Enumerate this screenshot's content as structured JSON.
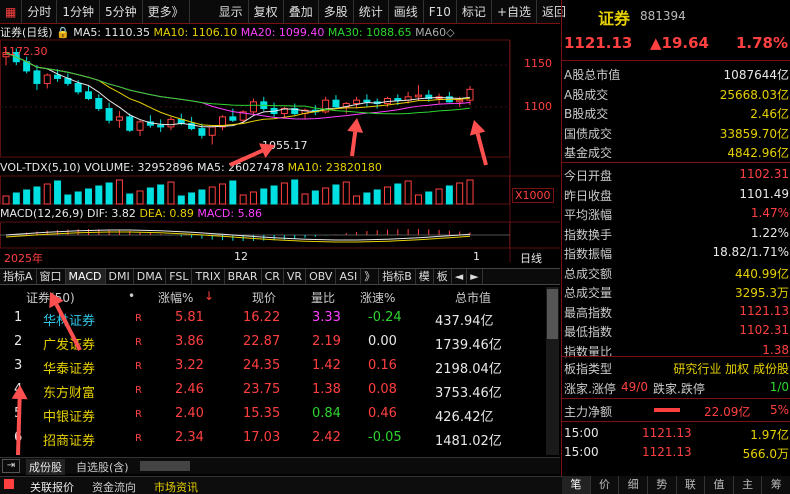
{
  "toolbar": {
    "left": [
      "分时",
      "1分钟",
      "5分钟",
      "更多》"
    ],
    "right": [
      "显示",
      "复权",
      "叠加",
      "多股",
      "统计",
      "画线",
      "F10",
      "标记",
      "+自选",
      "返回"
    ]
  },
  "main_chart": {
    "name": "证券(日线)",
    "ma5": "MA5: 1110.35",
    "ma10": "MA10: 1106.10",
    "ma20": "MA20: 1099.40",
    "ma30": "MA30: 1088.65",
    "ma60": "MA60◇",
    "high_label": "1172.30",
    "low_label": "1055.17",
    "price_ticks": [
      "1150",
      "1100"
    ],
    "year_label": "2025年",
    "month_labels": [
      "12",
      "1"
    ],
    "period_label": "日线",
    "ylim": [
      1040,
      1180
    ]
  },
  "volume": {
    "legend": "VOL-TDX(5,10)",
    "volume": "VOLUME: 32952896",
    "ma5": "MA5: 26027478",
    "ma10": "MA10: 23820180",
    "scale": "X1000"
  },
  "macd": {
    "legend": "MACD(12,26,9)",
    "dif": "DIF: 3.82",
    "dea": "DEA: 0.89",
    "macd": "MACD: 5.86"
  },
  "candles": [
    [
      1160,
      1172,
      1150,
      1165
    ],
    [
      1165,
      1170,
      1150,
      1154
    ],
    [
      1154,
      1160,
      1140,
      1143
    ],
    [
      1143,
      1150,
      1120,
      1128
    ],
    [
      1128,
      1140,
      1122,
      1138
    ],
    [
      1138,
      1145,
      1130,
      1134
    ],
    [
      1134,
      1140,
      1125,
      1128
    ],
    [
      1128,
      1132,
      1115,
      1118
    ],
    [
      1118,
      1125,
      1108,
      1110
    ],
    [
      1110,
      1115,
      1095,
      1098
    ],
    [
      1098,
      1105,
      1080,
      1084
    ],
    [
      1084,
      1095,
      1075,
      1088
    ],
    [
      1088,
      1092,
      1070,
      1072
    ],
    [
      1072,
      1085,
      1065,
      1082
    ],
    [
      1082,
      1090,
      1075,
      1078
    ],
    [
      1078,
      1085,
      1070,
      1076
    ],
    [
      1076,
      1088,
      1072,
      1085
    ],
    [
      1085,
      1092,
      1078,
      1080
    ],
    [
      1080,
      1088,
      1072,
      1074
    ],
    [
      1074,
      1080,
      1062,
      1066
    ],
    [
      1066,
      1078,
      1055,
      1076
    ],
    [
      1076,
      1090,
      1072,
      1088
    ],
    [
      1088,
      1098,
      1082,
      1084
    ],
    [
      1084,
      1096,
      1080,
      1094
    ],
    [
      1094,
      1110,
      1090,
      1106
    ],
    [
      1106,
      1112,
      1095,
      1098
    ],
    [
      1098,
      1105,
      1088,
      1092
    ],
    [
      1092,
      1100,
      1086,
      1098
    ],
    [
      1098,
      1104,
      1090,
      1092
    ],
    [
      1092,
      1098,
      1085,
      1096
    ],
    [
      1096,
      1102,
      1090,
      1094
    ],
    [
      1094,
      1112,
      1092,
      1108
    ],
    [
      1108,
      1114,
      1098,
      1100
    ],
    [
      1100,
      1106,
      1092,
      1104
    ],
    [
      1104,
      1112,
      1098,
      1108
    ],
    [
      1108,
      1115,
      1100,
      1106
    ],
    [
      1106,
      1110,
      1098,
      1104
    ],
    [
      1104,
      1112,
      1100,
      1110
    ],
    [
      1110,
      1115,
      1102,
      1108
    ],
    [
      1108,
      1118,
      1104,
      1112
    ],
    [
      1112,
      1126,
      1108,
      1114
    ],
    [
      1114,
      1120,
      1106,
      1110
    ],
    [
      1110,
      1116,
      1104,
      1112
    ],
    [
      1112,
      1118,
      1105,
      1106
    ],
    [
      1106,
      1112,
      1100,
      1108
    ],
    [
      1108,
      1125,
      1102,
      1121
    ]
  ],
  "arrows": [
    {
      "from": [
        230,
        165
      ],
      "to": [
        275,
        145
      ]
    },
    {
      "from": [
        352,
        156
      ],
      "to": [
        357,
        118
      ]
    },
    {
      "from": [
        486,
        165
      ],
      "to": [
        474,
        120
      ]
    },
    {
      "from": [
        18,
        455
      ],
      "to": [
        20,
        385
      ]
    },
    {
      "from": [
        80,
        350
      ],
      "to": [
        50,
        292
      ]
    }
  ],
  "funcbar": [
    "指标A",
    "窗口",
    "MACD",
    "DMI",
    "DMA",
    "FSL",
    "TRIX",
    "BRAR",
    "CR",
    "VR",
    "OBV",
    "ASI",
    "》",
    "指标B",
    "模",
    "板",
    "◄",
    "►"
  ],
  "table": {
    "headers": [
      "证券(50)",
      "•",
      "涨幅%",
      "↓",
      "现价",
      "量比",
      "涨速%",
      "总市值"
    ],
    "rows": [
      {
        "idx": "1",
        "name": "华林证券",
        "flag": "R",
        "chg": "5.81",
        "price": "16.22",
        "vol_ratio": "3.33",
        "speed": "-0.24",
        "mcap": "437.94亿",
        "hl": true
      },
      {
        "idx": "2",
        "name": "广发证券",
        "flag": "R",
        "chg": "3.86",
        "price": "22.87",
        "vol_ratio": "2.19",
        "speed": "0.00",
        "mcap": "1739.46亿",
        "hl": false
      },
      {
        "idx": "3",
        "name": "华泰证券",
        "flag": "R",
        "chg": "3.22",
        "price": "24.35",
        "vol_ratio": "1.42",
        "speed": "0.16",
        "mcap": "2198.04亿",
        "hl": false
      },
      {
        "idx": "4",
        "name": "东方财富",
        "flag": "R",
        "chg": "2.46",
        "price": "23.75",
        "vol_ratio": "1.38",
        "speed": "0.08",
        "mcap": "3753.46亿",
        "hl": false
      },
      {
        "idx": "5",
        "name": "中银证券",
        "flag": "R",
        "chg": "2.40",
        "price": "15.35",
        "vol_ratio": "0.84",
        "speed": "0.46",
        "mcap": "426.42亿",
        "hl": false
      },
      {
        "idx": "6",
        "name": "招商证券",
        "flag": "R",
        "chg": "2.34",
        "price": "17.03",
        "vol_ratio": "2.42",
        "speed": "-0.05",
        "mcap": "1481.02亿",
        "hl": false
      }
    ]
  },
  "bottom_tabs": [
    "成份股",
    "自选股(含)"
  ],
  "statusbar": [
    "关联报价",
    "资金流向",
    "市场资讯"
  ],
  "right_panel": {
    "title": "证券",
    "code": "881394",
    "price": "1121.13",
    "change": "▲19.64",
    "pct": "1.78%",
    "rows1": [
      {
        "label": "A股总市值",
        "value": "1087644亿",
        "color": "white"
      },
      {
        "label": "A股成交",
        "value": "25668.03亿",
        "color": "yellow"
      },
      {
        "label": "B股成交",
        "value": "2.46亿",
        "color": "yellow"
      },
      {
        "label": "国债成交",
        "value": "33859.70亿",
        "color": "yellow"
      },
      {
        "label": "基金成交",
        "value": "4842.96亿",
        "color": "yellow"
      }
    ],
    "rows2": [
      {
        "label": "今日开盘",
        "value": "1102.31",
        "color": "red"
      },
      {
        "label": "昨日收盘",
        "value": "1101.49",
        "color": "white"
      },
      {
        "label": "平均涨幅",
        "value": "1.47%",
        "color": "red"
      },
      {
        "label": "指数换手",
        "value": "1.22%",
        "color": "white"
      },
      {
        "label": "指数振幅",
        "value": "18.82/1.71%",
        "color": "white"
      },
      {
        "label": "总成交额",
        "value": "440.99亿",
        "color": "yellow"
      },
      {
        "label": "总成交量",
        "value": "3295.3万",
        "color": "yellow"
      },
      {
        "label": "最高指数",
        "value": "1121.13",
        "color": "red"
      },
      {
        "label": "最低指数",
        "value": "1102.31",
        "color": "red"
      },
      {
        "label": "指数量比",
        "value": "1.38",
        "color": "red"
      }
    ],
    "sector_label": "板指类型",
    "sector_value": "研究行业 加权 成份股",
    "updown_label1": "涨家.涨停",
    "updown_val1": "49/0",
    "updown_label2": "跌家.跌停",
    "updown_val2": "1/0",
    "inflow_label": "主力净额",
    "inflow_value": "22.09亿",
    "inflow_pct": "5%",
    "ticks": [
      {
        "time": "15:00",
        "price": "1121.13",
        "vol": "1.97亿"
      },
      {
        "time": "15:00",
        "price": "1121.13",
        "vol": "566.0万"
      }
    ],
    "bottom_tabs": [
      "笔",
      "价",
      "细",
      "势",
      "联",
      "值",
      "主",
      "筹"
    ]
  },
  "colors": {
    "up": "#ff4040",
    "down": "#00e0e0",
    "ma5": "#e8e8e8",
    "ma10": "#e6d000",
    "ma20": "#ff40ff",
    "ma30": "#2ed52e",
    "accent": "#7a1010"
  }
}
